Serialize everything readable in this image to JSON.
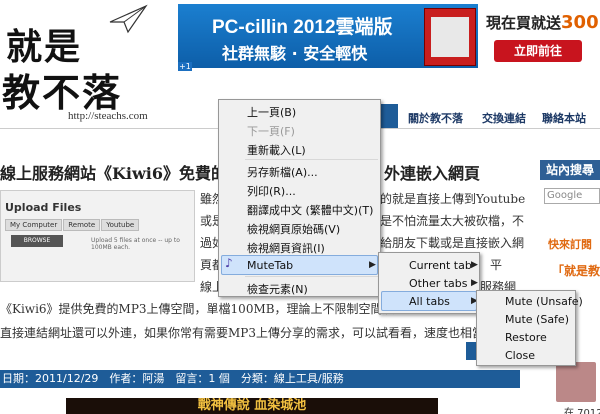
{
  "logo": {
    "line1": "就是",
    "line2": "教不落",
    "url": "http://steachs.com"
  },
  "ad": {
    "title": "PC-cillin 2012雲端版",
    "subtitle": "社群無駭 · 安全輕快",
    "promo_prefix": "現在買就送",
    "promo_amount": "300",
    "button": "立即前往",
    "badge": "+1"
  },
  "nav": {
    "items": [
      "關於教不落",
      "交換連結",
      "聯絡本站"
    ]
  },
  "article": {
    "title_left": "線上服務網站《Kiwi6》免費的",
    "title_right": "外連嵌入網頁",
    "upload": {
      "heading": "Upload Files",
      "tabs": [
        "My Computer",
        "Remote",
        "Youtube"
      ],
      "button": "BROWSE",
      "note": "Upload 5 files at once -- up to 100MB each."
    },
    "lines": [
      "雖然",
      "的就是直接上傳到Youtube",
      "或是",
      "是不怕流量太大被砍檔，不",
      "過如",
      "給朋友下載或是直接嵌入網",
      "頁都",
      "平",
      "線上",
      "嵌入",
      "服務網"
    ],
    "para1": "《Kiwi6》提供免費的MP3上傳空間，單檔100MB，理論上不限制空間及",
    "para2": "直接連結網址還可以外連，如果你常有需要MP3上傳分享的需求，可以試看看，速度也相當的",
    "meta": "日期：2011/12/29　作者：阿湯　留言：1 個　分類：線上工具/服務",
    "bottom_ad": "戰神傳說 血染城池"
  },
  "sidebar": {
    "heading": "站內搜尋",
    "search_placeholder": "Google",
    "subscribe": "快來訂閱",
    "subscribe2": "「就是教",
    "visitor_count": "在 7012 個"
  },
  "context_menu": {
    "items": [
      "上一頁(B)",
      "下一頁(F)",
      "重新載入(L)",
      "另存新檔(A)...",
      "列印(R)...",
      "翻譯成中文 (繁體中文)(T)",
      "檢視網頁原始碼(V)",
      "檢視網頁資訊(I)",
      "MuteTab",
      "檢查元素(N)"
    ]
  },
  "submenu1": {
    "items": [
      "Current tab",
      "Other tabs",
      "All tabs"
    ]
  },
  "submenu2": {
    "items": [
      "Mute (Unsafe)",
      "Mute (Safe)",
      "Restore",
      "Close"
    ]
  }
}
